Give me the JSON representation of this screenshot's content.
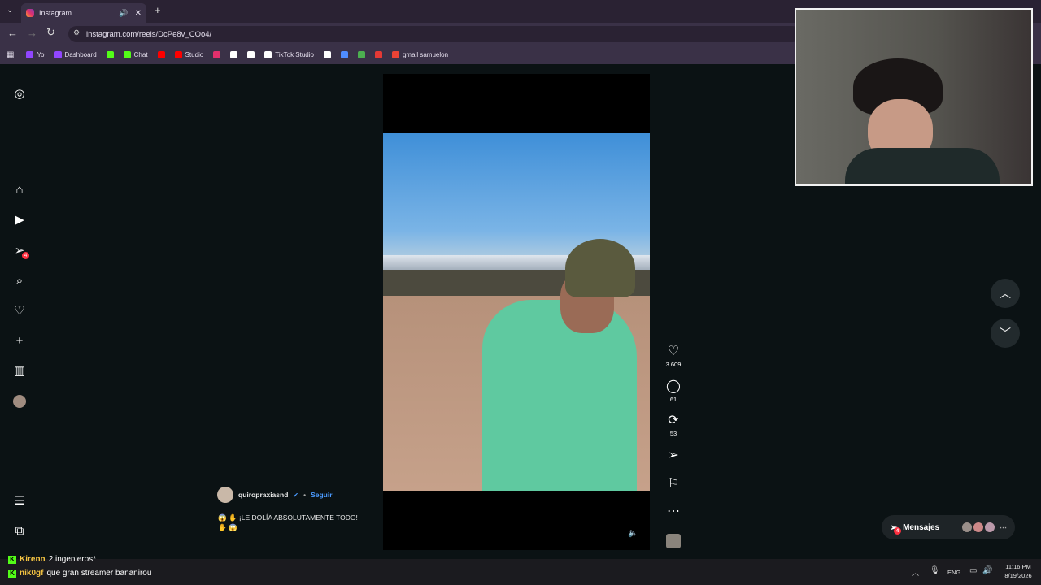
{
  "browser": {
    "tab_title": "Instagram",
    "url": "instagram.com/reels/DcPe8v_COo4/",
    "bookmarks": [
      {
        "label": "Yo",
        "color": "#9146ff"
      },
      {
        "label": "Dashboard",
        "color": "#9146ff"
      },
      {
        "label": "",
        "color": "#53fc18"
      },
      {
        "label": "Chat",
        "color": "#53fc18"
      },
      {
        "label": "",
        "color": "#ff0000"
      },
      {
        "label": "Studio",
        "color": "#ff0000"
      },
      {
        "label": "",
        "color": "#e1306c"
      },
      {
        "label": "",
        "color": "#ffffff"
      },
      {
        "label": "",
        "color": "#ffffff"
      },
      {
        "label": "TikTok Studio",
        "color": "#ffffff"
      },
      {
        "label": "",
        "color": "#ffffff"
      },
      {
        "label": "",
        "color": "#4f8cff"
      },
      {
        "label": "",
        "color": "#4caf50"
      },
      {
        "label": "",
        "color": "#e53935"
      },
      {
        "label": "gmail samuelon",
        "color": "#ea4335"
      }
    ]
  },
  "sidebar": {
    "notification_count": "4"
  },
  "reel": {
    "author": "quiropraxiasnd",
    "follow_label": "Seguir",
    "caption_line1": "😱 ✋ ¡LE DOLÍA ABSOLUTAMENTE TODO!",
    "caption_line2": "✋ 😱",
    "caption_more": "...",
    "likes": "3.609",
    "comments": "61",
    "reposts": "53"
  },
  "messages": {
    "label": "Mensajes",
    "badge": "4"
  },
  "stream_chat": [
    {
      "user": "Kirenn",
      "text": "2 ingenieros*"
    },
    {
      "user": "nik0gf",
      "text": "que gran streamer bananirou"
    }
  ],
  "taskbar": {
    "lang": "ENG",
    "time": "11:16 PM",
    "date": "8/19/2026"
  }
}
